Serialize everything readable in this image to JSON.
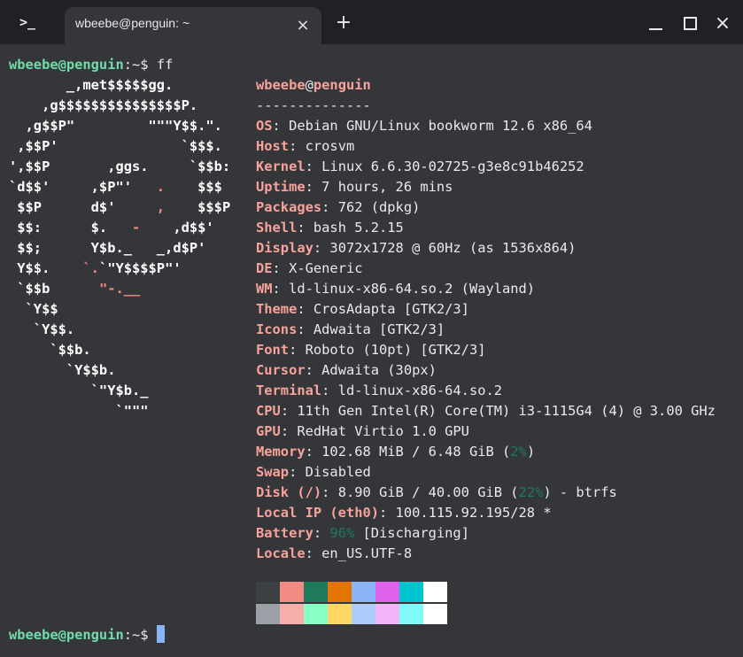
{
  "window": {
    "app_icon": ">_",
    "tab_title": "wbeebe@penguin: ~",
    "tab_close_icon": "×",
    "new_tab_icon": "+",
    "close_icon": "×"
  },
  "prompt": {
    "user_host": "wbeebe@penguin",
    "sep": ":~$ ",
    "command": "ff"
  },
  "logo": [
    "       _,met$$$$$gg.",
    "    ,g$$$$$$$$$$$$$$$P.",
    "  ,g$$P\"         \"\"\"Y$$.\".",
    " ,$$P'               `$$$.",
    "',$$P       ,ggs.     `$$b:",
    "`d$$'     ,$P\"'   .    $$$",
    " $$P      d$'     ,    $$$P",
    " $$:      $.   -    ,d$$'",
    " $$;      Y$b._   _,d$P'",
    " Y$$.    `.`\"Y$$$$P\"'",
    " `$$b      \"-.__",
    "  `Y$$",
    "   `Y$$.",
    "     `$$b.",
    "       `Y$$b.",
    "          `\"Y$b._",
    "             `\"\"\""
  ],
  "header": {
    "user": "wbeebe",
    "at": "@",
    "host": "penguin",
    "separator": "--------------"
  },
  "info": [
    {
      "key": "OS",
      "value": "Debian GNU/Linux bookworm 12.6 x86_64"
    },
    {
      "key": "Host",
      "value": "crosvm"
    },
    {
      "key": "Kernel",
      "value": "Linux 6.6.30-02725-g3e8c91b46252"
    },
    {
      "key": "Uptime",
      "value": "7 hours, 26 mins"
    },
    {
      "key": "Packages",
      "value": "762 (dpkg)"
    },
    {
      "key": "Shell",
      "value": "bash 5.2.15"
    },
    {
      "key": "Display",
      "value": "3072x1728 @ 60Hz (as 1536x864)"
    },
    {
      "key": "DE",
      "value": "X-Generic"
    },
    {
      "key": "WM",
      "value": "ld-linux-x86-64.so.2 (Wayland)"
    },
    {
      "key": "Theme",
      "value": "CrosAdapta [GTK2/3]"
    },
    {
      "key": "Icons",
      "value": "Adwaita [GTK2/3]"
    },
    {
      "key": "Font",
      "value": "Roboto (10pt) [GTK2/3]"
    },
    {
      "key": "Cursor",
      "value": "Adwaita (30px)"
    },
    {
      "key": "Terminal",
      "value": "ld-linux-x86-64.so.2"
    },
    {
      "key": "CPU",
      "value": "11th Gen Intel(R) Core(TM) i3-1115G4 (4) @ 3.00 GHz"
    },
    {
      "key": "GPU",
      "value": "RedHat Virtio 1.0 GPU"
    },
    {
      "key": "Memory",
      "value": "102.68 MiB / 6.48 GiB (",
      "accent": "2%",
      "tail": ")"
    },
    {
      "key": "Swap",
      "value": "Disabled"
    },
    {
      "key": "Disk (/)",
      "value": "8.90 GiB / 40.00 GiB (",
      "accent": "22%",
      "tail": ") - btrfs"
    },
    {
      "key": "Local IP (eth0)",
      "value": "100.115.92.195/28 *"
    },
    {
      "key": "Battery",
      "value": "",
      "accent": "96%",
      "tail": " [Discharging]"
    },
    {
      "key": "Locale",
      "value": "en_US.UTF-8"
    }
  ],
  "palette": {
    "row1": [
      "#3c4043",
      "#f28b82",
      "#1e7a5a",
      "#e37400",
      "#8ab4f8",
      "#e062ec",
      "#00c5cd",
      "#ffffff"
    ],
    "row2": [
      "#9aa0a6",
      "#f6aea9",
      "#87ffc5",
      "#fdd663",
      "#aecbfa",
      "#f3b5fa",
      "#80f9f9",
      "#ffffff"
    ]
  },
  "colors": {
    "terminal_bg": "#35363a",
    "titlebar_bg": "#202124",
    "prompt_green": "#71dbac",
    "key_salmon": "#f7a29a",
    "cursor_blue": "#8ab4f8"
  },
  "final_prompt": {
    "user_host": "wbeebe@penguin",
    "sep": ":~$ "
  }
}
